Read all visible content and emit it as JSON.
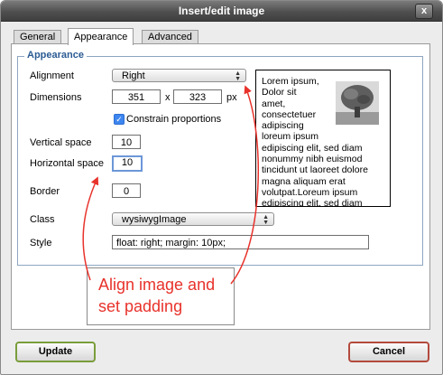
{
  "window": {
    "title": "Insert/edit image",
    "close_label": "x"
  },
  "tabs": [
    {
      "label": "General",
      "active": false
    },
    {
      "label": "Appearance",
      "active": true
    },
    {
      "label": "Advanced",
      "active": false
    }
  ],
  "appearance": {
    "legend": "Appearance",
    "alignment": {
      "label": "Alignment",
      "value": "Right"
    },
    "dimensions": {
      "label": "Dimensions",
      "width": "351",
      "separator": "x",
      "height": "323",
      "unit": "px"
    },
    "constrain": {
      "label": "Constrain proportions",
      "checked": true
    },
    "vertical_space": {
      "label": "Vertical space",
      "value": "10"
    },
    "horizontal_space": {
      "label": "Horizontal space",
      "value": "10"
    },
    "border": {
      "label": "Border",
      "value": "0"
    },
    "class": {
      "label": "Class",
      "value": "wysiwygImage"
    },
    "style": {
      "label": "Style",
      "value": "float: right; margin: 10px;"
    }
  },
  "preview": {
    "lines": [
      "Lorem ipsum,",
      "Dolor sit",
      "amet,",
      "consectetuer",
      "adipiscing",
      "loreum ipsum",
      "edipiscing elit, sed diam",
      "nonummy nibh euismod",
      "tincidunt ut laoreet dolore",
      "magna aliquam erat",
      "volutpat.Loreum ipsum",
      "edipiscing elit, sed diam"
    ]
  },
  "callout": {
    "line1": "Align image and",
    "line2": "set padding"
  },
  "buttons": {
    "update": "Update",
    "cancel": "Cancel"
  },
  "colors": {
    "annotation": "#e8322b",
    "update_border": "#7a9d3b",
    "cancel_border": "#b34a3d",
    "legend": "#2b5b93"
  }
}
